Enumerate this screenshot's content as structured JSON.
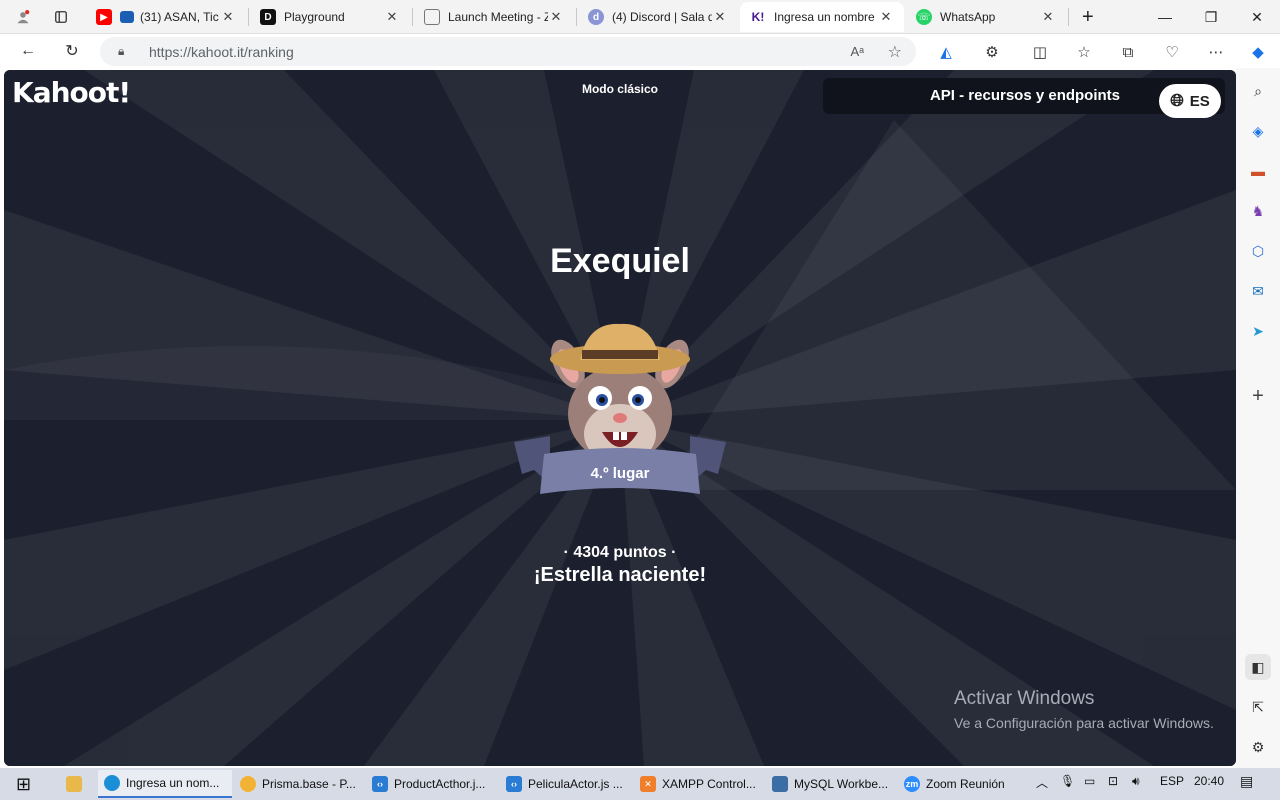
{
  "browser": {
    "tabs": [
      {
        "title": "(31) ASAN, Tic",
        "icon": "youtube-icon",
        "color": "#ff0000"
      },
      {
        "title": "Playground",
        "icon": "playground-icon",
        "color": "#111111"
      },
      {
        "title": "Launch Meeting - Z",
        "icon": "document-icon",
        "color": "#888888"
      },
      {
        "title": "(4) Discord | Sala d",
        "icon": "discord-icon",
        "color": "#8a95d6"
      },
      {
        "title": "Ingresa un nombre",
        "icon": "kahoot-icon",
        "color": "#46178f"
      },
      {
        "title": "WhatsApp",
        "icon": "whatsapp-icon",
        "color": "#25d366"
      }
    ],
    "url": "https://kahoot.it/ranking"
  },
  "page": {
    "mode": "Modo clásico",
    "api_label": "API - recursos y endpoints",
    "language": "ES",
    "player_name": "Exequiel",
    "rank": "4.º lugar",
    "points": "· 4304 puntos ·",
    "message": "¡Estrella naciente!"
  },
  "watermark": {
    "title": "Activar Windows",
    "subtitle": "Ve a Configuración para activar Windows."
  },
  "taskbar": {
    "apps": [
      {
        "label": "Ingresa un nom...",
        "color": "#1b8fd6"
      },
      {
        "label": "Prisma.base - P...",
        "color": "#f2b234"
      },
      {
        "label": "ProductActhor.j...",
        "color": "#2a7bd4"
      },
      {
        "label": "PeliculaActor.js ...",
        "color": "#2a7bd4"
      },
      {
        "label": "XAMPP Control...",
        "color": "#f07f2b"
      },
      {
        "label": "MySQL Workbe...",
        "color": "#3a6ea5"
      },
      {
        "label": "Zoom Reunión",
        "color": "#2d8cff"
      }
    ],
    "language": "ESP",
    "time": "20:40"
  }
}
